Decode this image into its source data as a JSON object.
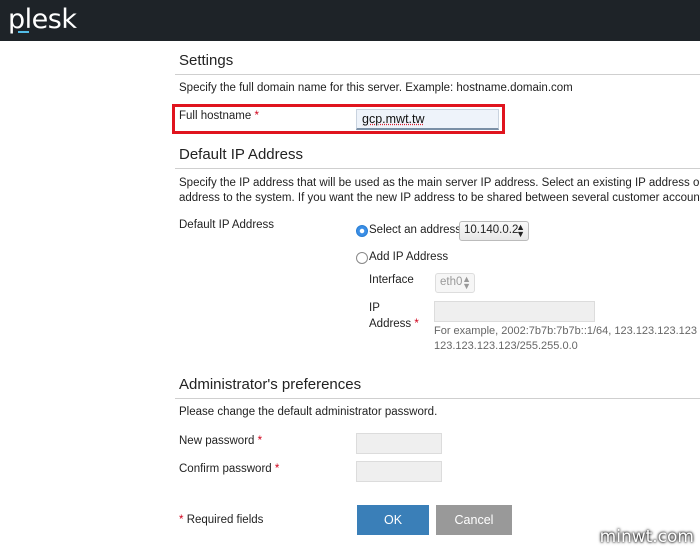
{
  "app": {
    "logo_text": "plesk"
  },
  "settings": {
    "title": "Settings",
    "description": "Specify the full domain name for this server. Example: hostname.domain.com",
    "hostname_label": "Full hostname",
    "hostname_value": "gcp.mwt.tw"
  },
  "ip": {
    "title": "Default IP Address",
    "description_line1": "Specify the IP address that will be used as the main server IP address. Select an existing IP address or cli",
    "description_line2": "address to the system. If you want the new IP address to be shared between several customer accounts,",
    "field_label": "Default IP Address",
    "option_select_label": "Select an address",
    "selected_address": "10.140.0.2",
    "option_add_label": "Add IP Address",
    "interface_label": "Interface",
    "interface_value": "eth0",
    "ip_address_label_1": "IP",
    "ip_address_label_2": "Address",
    "example_line1": "For example, 2002:7b7b:7b7b::1/64, 123.123.123.123",
    "example_line2": "123.123.123.123/255.255.0.0"
  },
  "admin": {
    "title": "Administrator's preferences",
    "description": "Please change the default administrator password.",
    "new_password_label": "New password",
    "confirm_password_label": "Confirm password"
  },
  "form": {
    "required_note": "Required fields",
    "required_mark": "*",
    "ok_label": "OK",
    "cancel_label": "Cancel"
  },
  "watermark": "minwt.com",
  "colors": {
    "accent": "#3a7fb8",
    "required": "#d0021b",
    "highlight": "#e0141e",
    "topbar": "#1e2328"
  }
}
